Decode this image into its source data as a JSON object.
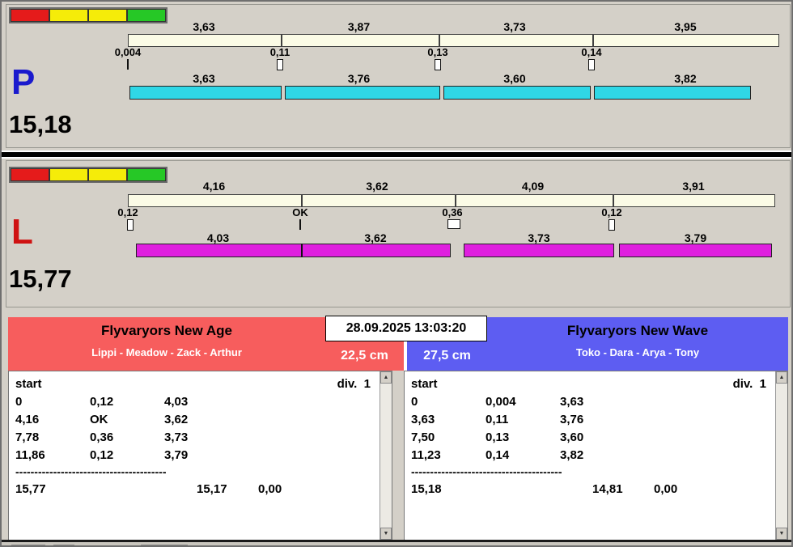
{
  "timestamp": "28.09.2025 13:03:20",
  "lane_p": {
    "label": "P",
    "total": "15,18",
    "upper_values": [
      "3,63",
      "3,87",
      "3,73",
      "3,95"
    ],
    "splits": [
      "0,004",
      "0,11",
      "0,13",
      "0,14"
    ],
    "lower_values": [
      "3,63",
      "3,76",
      "3,60",
      "3,82"
    ]
  },
  "lane_l": {
    "label": "L",
    "total": "15,77",
    "upper_values": [
      "4,16",
      "3,62",
      "4,09",
      "3,91"
    ],
    "splits": [
      "0,12",
      "OK",
      "0,36",
      "0,12"
    ],
    "lower_values": [
      "4,03",
      "3,62",
      "3,73",
      "3,79"
    ]
  },
  "left_team": {
    "name": "Flyvaryors New Age",
    "members": "Lippi - Meadow - Zack - Arthur",
    "distance": "22,5 cm",
    "table": {
      "start_label": "start",
      "div_label": "div.  1",
      "rows": [
        [
          "0",
          "0,12",
          "4,03"
        ],
        [
          "4,16",
          "OK",
          "3,62"
        ],
        [
          "7,78",
          "0,36",
          "3,73"
        ],
        [
          "11,86",
          "0,12",
          "3,79"
        ]
      ],
      "separator": "----------------------------------------",
      "totals": [
        "15,77",
        "15,17",
        "0,00"
      ]
    }
  },
  "right_team": {
    "name": "Flyvaryors New Wave",
    "members": "Toko - Dara - Arya - Tony",
    "distance": "27,5 cm",
    "table": {
      "start_label": "start",
      "div_label": "div.  1",
      "rows": [
        [
          "0",
          "0,004",
          "3,63"
        ],
        [
          "3,63",
          "0,11",
          "3,76"
        ],
        [
          "7,50",
          "0,13",
          "3,60"
        ],
        [
          "11,23",
          "0,14",
          "3,82"
        ]
      ],
      "separator": "----------------------------------------",
      "totals": [
        "15,18",
        "14,81",
        "0,00"
      ]
    }
  },
  "icons": {
    "scroll_up": "▲",
    "scroll_down": "▼"
  },
  "colors": {
    "background": "#d4d0c8",
    "lane_p_bar": "#2fd7e6",
    "lane_l_bar": "#df1fdf",
    "scale_bar": "#fbfbe6",
    "lane_p_label": "#1a1acd",
    "lane_l_label": "#cf1212",
    "team_left_bg": "#f75d5d",
    "team_right_bg": "#5d5df2",
    "light_red": "#e51b1b",
    "light_yellow": "#f5ec09",
    "light_green": "#26c826"
  }
}
